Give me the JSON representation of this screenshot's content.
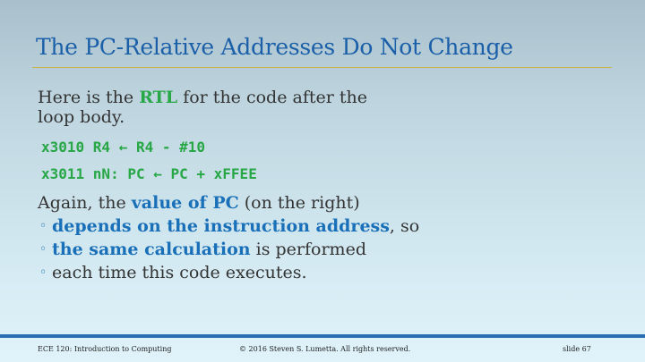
{
  "slide": {
    "title": "The PC-Relative Addresses Do Not Change",
    "intro": {
      "before": "Here is the ",
      "highlight": "RTL",
      "after_line1": " for the code after the",
      "line2": "loop body."
    },
    "code": [
      "x3010 R4 ← R4 - #10",
      "x3011 nN: PC ← PC + xFFEE"
    ],
    "again": {
      "before": "Again, the ",
      "highlight": "value of PC",
      "after": " (on the right)"
    },
    "bullets": [
      {
        "highlight": "depends on the instruction address",
        "after": ", so"
      },
      {
        "highlight": "the same calculation",
        "after": " is performed"
      },
      {
        "highlight": "",
        "after": "each time this code executes."
      }
    ],
    "bullet_symbol": "◦"
  },
  "footer": {
    "course": "ECE 120: Introduction to Computing",
    "copyright": "© 2016 Steven S. Lumetta.  All rights reserved.",
    "slide_number": "slide 67"
  }
}
